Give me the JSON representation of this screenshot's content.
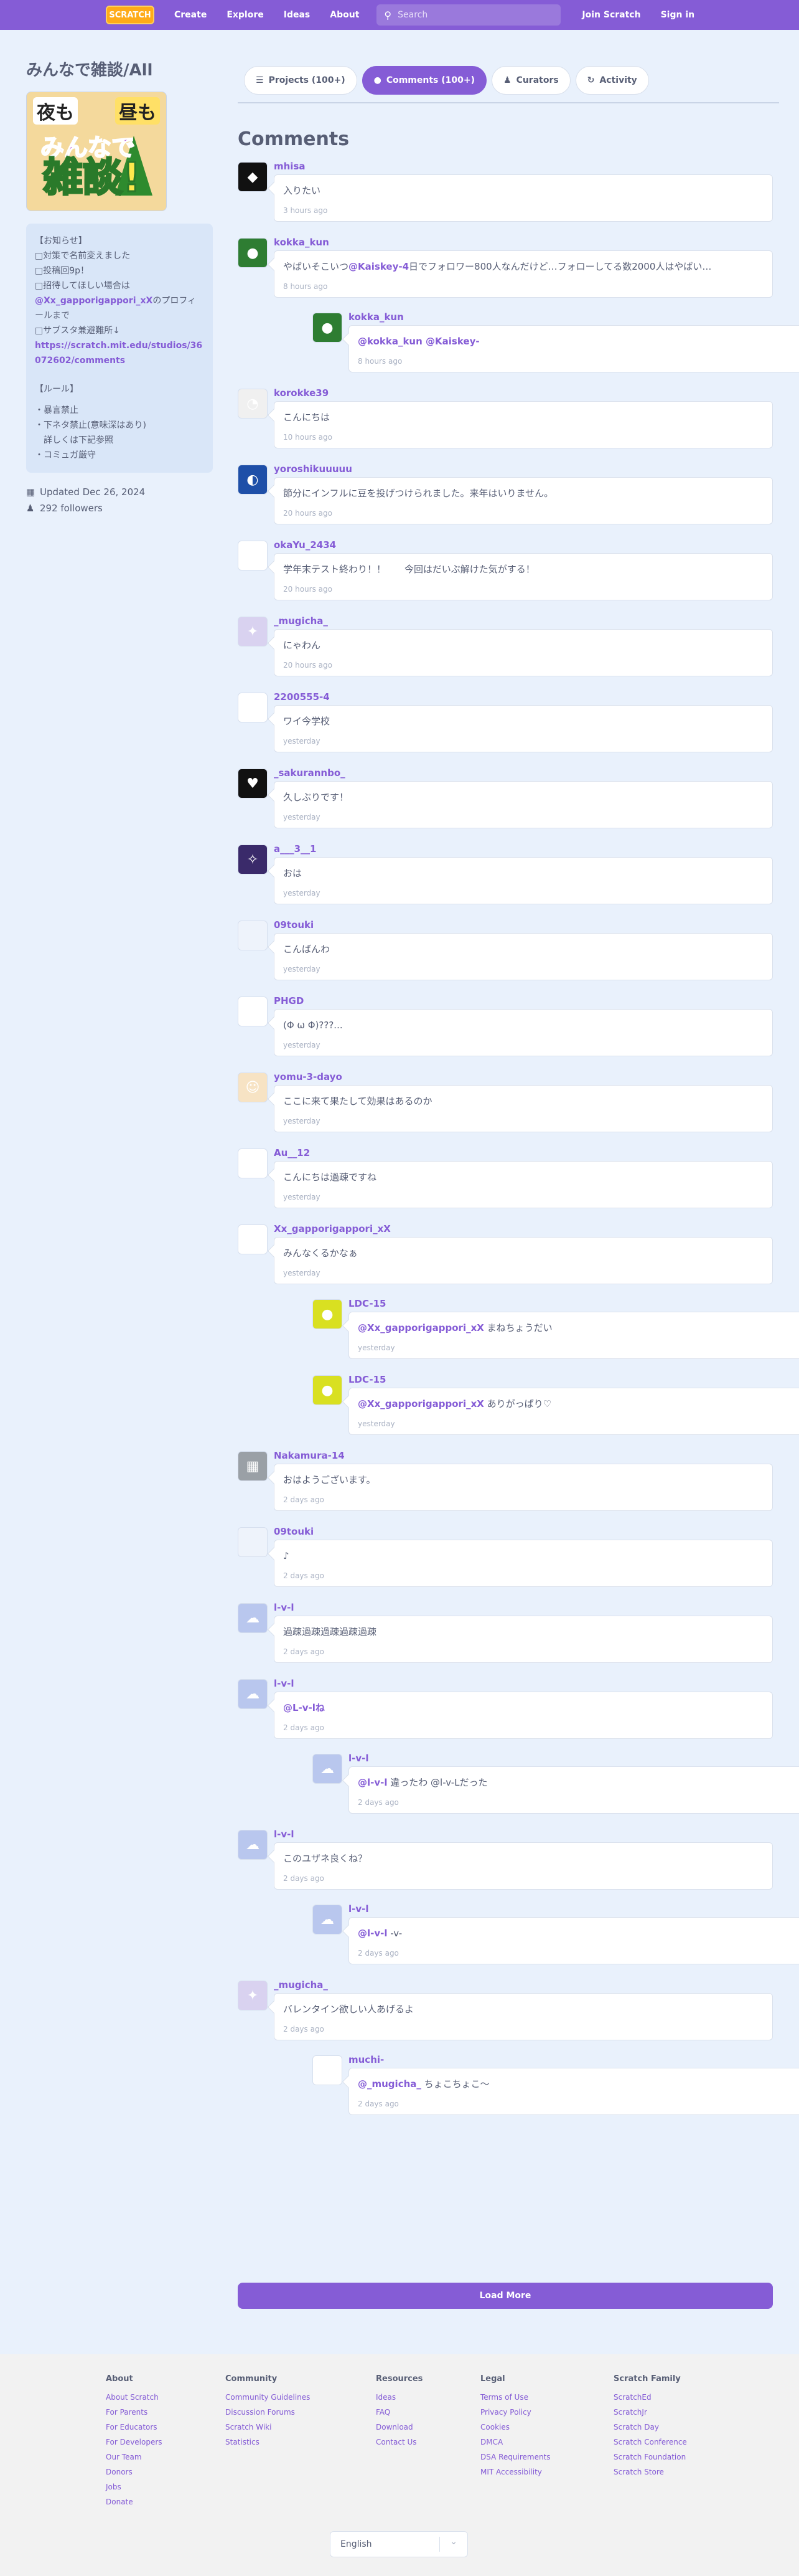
{
  "nav": {
    "logo": "SCRATCH",
    "links": [
      "Create",
      "Explore",
      "Ideas",
      "About"
    ],
    "search_placeholder": "Search",
    "join": "Join Scratch",
    "signin": "Sign in"
  },
  "studio": {
    "title": "みんなで雑談/All",
    "thumb_lines": [
      "夜も",
      "昼も",
      "みんなで",
      "雑談!"
    ],
    "notice": {
      "heading": "【お知らせ】",
      "lines": [
        "□対策で名前変えました",
        "□投稿回9p！",
        "□招待してほしい場合は"
      ],
      "mention": "@Xx_gapporigappori_xX",
      "after_mention": "のプロフィールまで",
      "sub": "□サブスタ兼避難所↓",
      "link": "https://scratch.mit.edu/studios/36072602/comments",
      "rules_heading": "【ルール】",
      "rules": [
        "・暴言禁止",
        "・下ネタ禁止(意味深はあり)",
        "　詳しくは下記参照",
        "・コミュガ厳守"
      ]
    },
    "updated": "Updated Dec 26, 2024",
    "followers": "292 followers"
  },
  "tabs": [
    {
      "label": "Projects (100+)",
      "icon": "projects-icon"
    },
    {
      "label": "Comments (100+)",
      "icon": "comments-icon"
    },
    {
      "label": "Curators",
      "icon": "curators-icon"
    },
    {
      "label": "Activity",
      "icon": "activity-icon"
    }
  ],
  "comments_heading": "Comments",
  "comments": [
    {
      "user": "mhisa",
      "text": "入りたい",
      "time": "3 hours ago",
      "avatar": "◆",
      "avbg": "#111111"
    },
    {
      "user": "kokka_kun",
      "text_mention": "@Kaiskey-4",
      "text_pre": "やばいそこいつ",
      "text": "日でフォロワー800人なんだけど…フォローしてる数2000人はやばい…",
      "time": "8 hours ago",
      "avatar": "●",
      "avbg": "#2e7d32",
      "replies": [
        {
          "user": "kokka_kun",
          "mentions": "@kokka_kun @Kaiskey-",
          "text": "",
          "time": "8 hours ago",
          "avatar": "●",
          "avbg": "#2e7d32"
        }
      ]
    },
    {
      "user": "korokke39",
      "text": "こんにちは",
      "time": "10 hours ago",
      "avatar": "◔",
      "avbg": "#f0f0f0"
    },
    {
      "user": "yoroshikuuuuu",
      "text": "節分にインフルに豆を投げつけられました。来年はいりません。",
      "time": "20 hours ago",
      "avatar": "◐",
      "avbg": "#1e4fa8"
    },
    {
      "user": "okaYu_2434",
      "text": "学年末テスト終わり！！　　今回はだいぶ解けた気がする！",
      "time": "20 hours ago",
      "avatar": "◕",
      "avbg": "#ffffff"
    },
    {
      "user": "_mugicha_",
      "text": "にゃわん",
      "time": "20 hours ago",
      "avatar": "✦",
      "avbg": "#d9d2f0"
    },
    {
      "user": "2200555-4",
      "text": "ワイ今学校",
      "time": "yesterday",
      "avatar": "◉",
      "avbg": "#ffffff"
    },
    {
      "user": "_sakurannbo_",
      "text": "久しぶりです！",
      "time": "yesterday",
      "avatar": "♥",
      "avbg": "#111111"
    },
    {
      "user": "a___3__1",
      "text": "おは",
      "time": "yesterday",
      "avatar": "✧",
      "avbg": "#3a2a6a"
    },
    {
      "user": "09touki",
      "text": "こんばんわ",
      "time": "yesterday",
      "avatar": "",
      "avbg": "#eef3fb"
    },
    {
      "user": "PHGD",
      "text": "(Φ ω Φ)???...",
      "time": "yesterday",
      "avatar": "■",
      "avbg": "#ffffff"
    },
    {
      "user": "yomu-3-dayo",
      "text": "ここに来て果たして効果はあるのか",
      "time": "yesterday",
      "avatar": "☺",
      "avbg": "#f7e3c4"
    },
    {
      "user": "Au__12",
      "text": "こんにちは過疎ですね",
      "time": "yesterday",
      "avatar": "✶",
      "avbg": "#ffffff"
    },
    {
      "user": "Xx_gapporigappori_xX",
      "text": "みんなくるかなぁ",
      "time": "yesterday",
      "avatar": "☻",
      "avbg": "#ffffff",
      "replies": [
        {
          "user": "LDC-15",
          "mentions": "@Xx_gapporigappori_xX",
          "text": " まねちょうだい",
          "time": "yesterday",
          "avatar": "●",
          "avbg": "#d9e021"
        },
        {
          "user": "LDC-15",
          "mentions": "@Xx_gapporigappori_xX",
          "text": " ありがっぱり♡",
          "time": "yesterday",
          "avatar": "●",
          "avbg": "#d9e021"
        }
      ]
    },
    {
      "user": "Nakamura-14",
      "text": "おはようございます。",
      "time": "2 days ago",
      "avatar": "▦",
      "avbg": "#9aa0a6"
    },
    {
      "user": "09touki",
      "text": "♪",
      "time": "2 days ago",
      "avatar": "",
      "avbg": "#eef3fb"
    },
    {
      "user": "l-v-l",
      "text": "過疎過疎過疎過疎過疎",
      "time": "2 days ago",
      "avatar": "☁",
      "avbg": "#b9c7ee"
    },
    {
      "user": "l-v-l",
      "mentions": "@L-v-lね",
      "text": "",
      "time": "2 days ago",
      "avatar": "☁",
      "avbg": "#b9c7ee",
      "replies": [
        {
          "user": "l-v-l",
          "mentions": "@l-v-l",
          "text": " 違ったわ @l-v-Lだった",
          "time": "2 days ago",
          "avatar": "☁",
          "avbg": "#b9c7ee"
        }
      ]
    },
    {
      "user": "l-v-l",
      "text": "このユザネ良くね？",
      "time": "2 days ago",
      "avatar": "☁",
      "avbg": "#b9c7ee",
      "replies": [
        {
          "user": "l-v-l",
          "mentions": "@l-v-l",
          "text": " -v-",
          "time": "2 days ago",
          "avatar": "☁",
          "avbg": "#b9c7ee"
        }
      ]
    },
    {
      "user": "_mugicha_",
      "text": "バレンタイン欲しい人あげるよ",
      "time": "2 days ago",
      "avatar": "✦",
      "avbg": "#d9d2f0",
      "replies": [
        {
          "user": "muchi-",
          "mentions": "@_mugicha_",
          "text": " ちょこちょこ〜",
          "time": "2 days ago",
          "avatar": "☺",
          "avbg": "#ffffff"
        }
      ]
    }
  ],
  "load_more": "Load More",
  "footer": {
    "columns": [
      {
        "heading": "About",
        "links": [
          "About Scratch",
          "For Parents",
          "For Educators",
          "For Developers",
          "Our Team",
          "Donors",
          "Jobs",
          "Donate"
        ]
      },
      {
        "heading": "Community",
        "links": [
          "Community Guidelines",
          "Discussion Forums",
          "Scratch Wiki",
          "Statistics"
        ]
      },
      {
        "heading": "Resources",
        "links": [
          "Ideas",
          "FAQ",
          "Download",
          "Contact Us"
        ]
      },
      {
        "heading": "Legal",
        "links": [
          "Terms of Use",
          "Privacy Policy",
          "Cookies",
          "DMCA",
          "DSA Requirements",
          "MIT Accessibility"
        ]
      },
      {
        "heading": "Scratch Family",
        "links": [
          "ScratchEd",
          "ScratchJr",
          "Scratch Day",
          "Scratch Conference",
          "Scratch Foundation",
          "Scratch Store"
        ]
      }
    ],
    "language": "English"
  }
}
